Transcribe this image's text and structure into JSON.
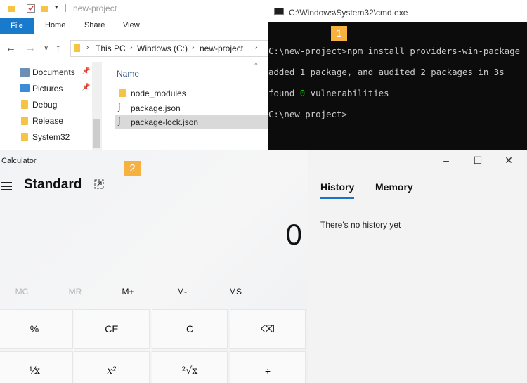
{
  "explorer": {
    "title": "new-project",
    "ribbon_tabs": [
      "File",
      "Home",
      "Share",
      "View"
    ],
    "breadcrumb": [
      "This PC",
      "Windows (C:)",
      "new-project"
    ],
    "sidebar": [
      {
        "label": "Documents",
        "icon": "documents-icon",
        "pinned": true
      },
      {
        "label": "Pictures",
        "icon": "pictures-icon",
        "pinned": true
      },
      {
        "label": "Debug",
        "icon": "folder-icon",
        "pinned": false
      },
      {
        "label": "Release",
        "icon": "folder-icon",
        "pinned": false
      },
      {
        "label": "System32",
        "icon": "folder-icon",
        "pinned": false
      }
    ],
    "column_header": "Name",
    "files": [
      {
        "name": "node_modules",
        "type": "folder",
        "selected": false
      },
      {
        "name": "package.json",
        "type": "json",
        "selected": false
      },
      {
        "name": "package-lock.json",
        "type": "json",
        "selected": true
      }
    ]
  },
  "cmd": {
    "title": "C:\\Windows\\System32\\cmd.exe",
    "lines": [
      "C:\\new-project>npm install providers-win-package",
      "added 1 package, and audited 2 packages in 3s",
      "found ",
      "C:\\new-project>"
    ],
    "vuln_count": "0",
    "vuln_suffix": " vulnerabilities"
  },
  "badges": [
    "1",
    "2"
  ],
  "calculator": {
    "title": "Calculator",
    "mode": "Standard",
    "display": "0",
    "memory_buttons": [
      "MC",
      "MR",
      "M+",
      "M-",
      "MS"
    ],
    "keys_row1": [
      "%",
      "CE",
      "C",
      "⌫"
    ],
    "keys_row2": [
      "¹⁄x",
      "x²",
      "²√x",
      "÷"
    ],
    "history_tab": "History",
    "memory_tab": "Memory",
    "history_empty": "There's no history yet"
  },
  "colors": {
    "accent_blue": "#1979ca",
    "badge_orange": "#f7b13e",
    "cmd_green": "#16c60c",
    "cmd_bg": "#0c0c0c"
  }
}
